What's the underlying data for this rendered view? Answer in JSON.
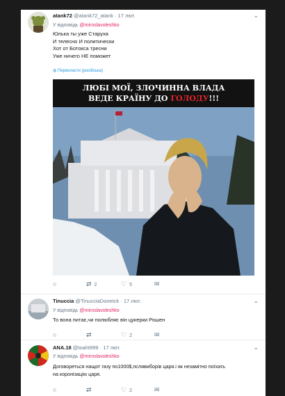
{
  "tweets": [
    {
      "name": "atank72",
      "handle": "@atank72_atank",
      "dot": "·",
      "time": "17 лют.",
      "reply_prefix": "У відповідь",
      "reply_to": "@miroslavoleshko",
      "lines": [
        "Юлька ты уже Старуха",
        "И телесно И политически",
        "Хот от Ботокса тресни",
        "Уже ничего НЕ поможет"
      ],
      "translate": "Перекласти (російська)",
      "media": {
        "banner_line1": "ЛЮБІ МОЇ, ЗЛОЧИННА ВЛАДА",
        "banner_line2_prefix": "ВЕДЕ КРАЇНУ ДО ",
        "banner_line2_red": "ГОЛОДУ",
        "banner_line2_suffix": "!!!"
      },
      "actions": {
        "reply": "",
        "retweet": "2",
        "like": "5"
      }
    },
    {
      "name": "Tinuccia",
      "handle": "@TinucciaDonetck",
      "dot": "·",
      "time": "17 лют.",
      "reply_prefix": "У відповідь",
      "reply_to": "@miroslavoleshko",
      "lines": [
        "То вона питає,чи полюбляє він цукерки Рошен"
      ],
      "actions": {
        "reply": "",
        "retweet": "",
        "like": "2"
      }
    },
    {
      "name": "ANA.18",
      "handle": "@toaht999",
      "dot": "·",
      "time": "17 лют.",
      "reply_prefix": "У відповідь",
      "reply_to": "@miroslavoleshko",
      "lines": [
        "Договореться нащот газу по1000$,пслявиборів царя.і як незамітно поїхать",
        "на коронізацію царя."
      ],
      "actions": {
        "reply": "",
        "retweet": "",
        "like": "2"
      }
    }
  ],
  "icons": {
    "chevron": "chevron-down-icon",
    "reply": "reply-icon",
    "retweet": "retweet-icon",
    "like": "heart-icon",
    "dm": "envelope-icon"
  },
  "colors": {
    "mention": "#e0245e",
    "link": "#1b95e0",
    "muted": "#657786"
  }
}
